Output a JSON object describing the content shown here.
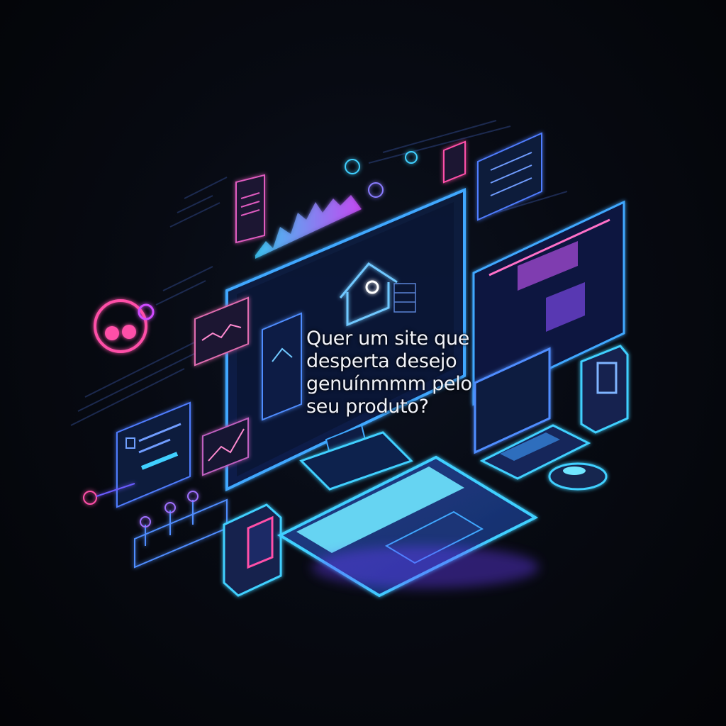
{
  "headline": {
    "line1": "Quer um site que",
    "line2": "desperta desejo",
    "line3": "genuínmmm  pelo",
    "line4": "seu produto?"
  },
  "colors": {
    "background": "#05070c",
    "glow_cyan": "#3fd0ff",
    "glow_blue": "#3b6dff",
    "glow_magenta": "#d04cff",
    "glow_pink": "#ff4fa8",
    "text": "#f2f4fb"
  },
  "icons": [
    "monitor",
    "laptop",
    "keyboard",
    "mouse",
    "server",
    "house",
    "headset",
    "chart",
    "document",
    "network"
  ]
}
